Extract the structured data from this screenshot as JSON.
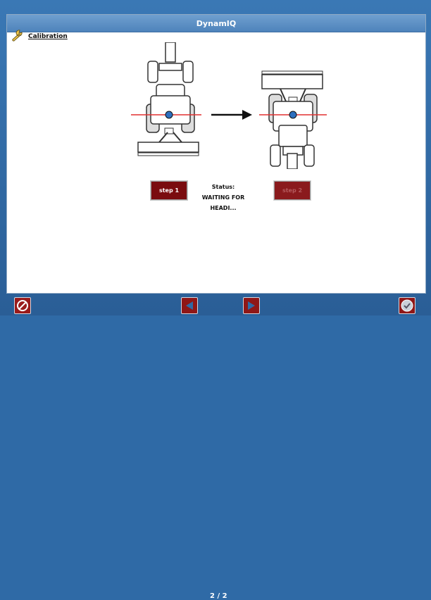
{
  "app": {
    "title": "DynamIQ"
  },
  "section": {
    "label": "Calibration",
    "icon": "wrench-icon"
  },
  "controls": {
    "step1_label": "step 1",
    "step2_label": "step 2",
    "status_label": "Status:",
    "status_value": "WAITING  FOR HEADI..."
  },
  "footer": {
    "page_indicator": "2 / 2",
    "left_button_icon": "no-entry-icon",
    "prev_icon": "left-arrow-icon",
    "next_icon": "right-arrow-icon",
    "right_button_icon": "check-icon"
  },
  "colors": {
    "header": "#4e83bb",
    "footer": "#2a5e96",
    "step1_bg": "#7a0c0f",
    "step2_bg": "#8a1a1d",
    "red_line": "#e23131",
    "dot": "#2d6fbe"
  }
}
